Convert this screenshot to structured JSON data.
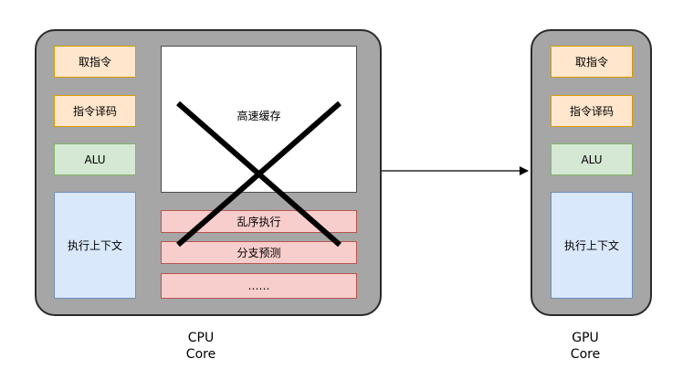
{
  "cpu": {
    "fetch": "取指令",
    "decode": "指令译码",
    "alu": "ALU",
    "context": "执行上下文",
    "cache": "高速缓存",
    "out_of_order": "乱序执行",
    "branch_prediction": "分支预测",
    "more": "……",
    "caption_line1": "CPU",
    "caption_line2": "Core"
  },
  "gpu": {
    "fetch": "取指令",
    "decode": "指令译码",
    "alu": "ALU",
    "context": "执行上下文",
    "caption_line1": "GPU",
    "caption_line2": "Core"
  },
  "colors": {
    "core_fill": "#a6a6a6",
    "orange_fill": "#ffe6cc",
    "green_fill": "#d5e8d4",
    "blue_fill": "#dae8fc",
    "red_fill": "#f8cecc",
    "cross_stroke": "#000000"
  },
  "icons": {
    "cross": "cross-out-icon",
    "arrow": "arrow-right-icon"
  }
}
